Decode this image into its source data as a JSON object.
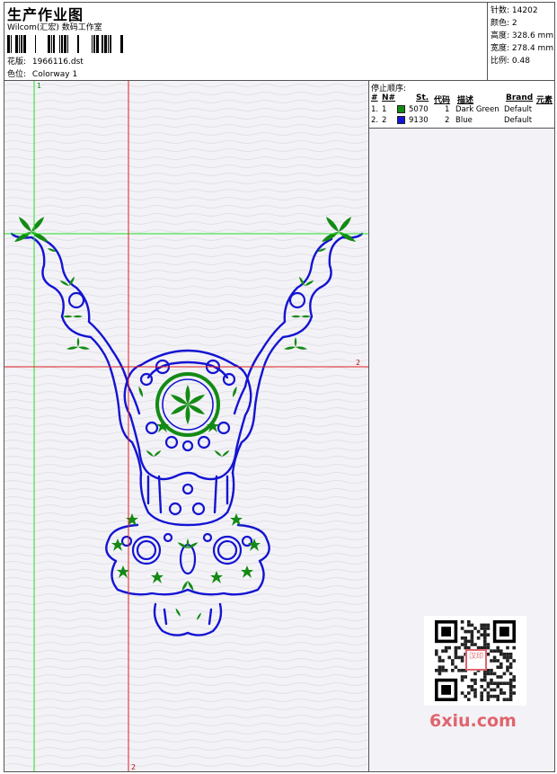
{
  "header": {
    "title": "生产作业图",
    "subtitle": "Wilcom(汇宏) 数码工作室",
    "design_label": "花版:",
    "design_value": "1966116.dst",
    "colorway_label": "色位:",
    "colorway_value": "Colorway 1"
  },
  "stats": [
    {
      "label": "针数:",
      "value": "14202"
    },
    {
      "label": "颜色:",
      "value": "2"
    },
    {
      "label": "高度:",
      "value": "328.6 mm"
    },
    {
      "label": "宽度:",
      "value": "278.4 mm"
    },
    {
      "label": "比例:",
      "value": "0.48"
    }
  ],
  "stop_sequence": {
    "title": "停止顺序:",
    "columns": [
      "#",
      "N#",
      "St.",
      "代码",
      "描述",
      "Brand",
      "元素"
    ],
    "rows": [
      {
        "index": "1.",
        "n": "1",
        "stitches": "5070",
        "code": "1",
        "description": "Dark Green",
        "brand": "Default",
        "color": "#138a14"
      },
      {
        "index": "2.",
        "n": "2",
        "stitches": "9130",
        "code": "2",
        "description": "Blue",
        "brand": "Default",
        "color": "#1414d2"
      }
    ]
  },
  "guides": {
    "vertical_green_label": "1",
    "horizontal_red_label": "2",
    "vertical_red_label": "2"
  },
  "watermark": {
    "site": "6xiu.com",
    "seal": "汉印"
  },
  "colors": {
    "thread_green": "#138a14",
    "thread_blue": "#1414d2",
    "guide_green": "#22dd22",
    "guide_red": "#dd2020"
  }
}
